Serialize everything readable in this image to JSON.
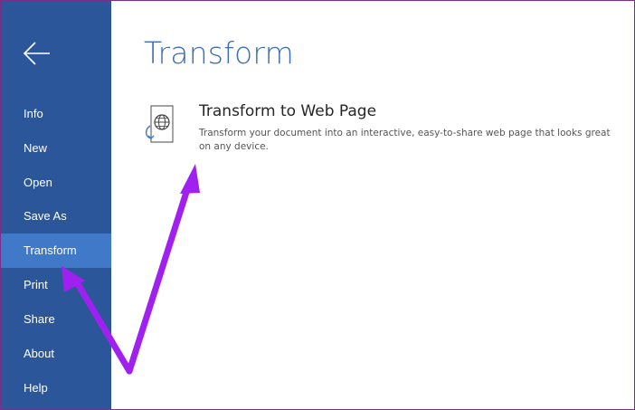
{
  "sidebar": {
    "back_icon": "back-arrow-icon",
    "items": [
      {
        "label": "Info"
      },
      {
        "label": "New"
      },
      {
        "label": "Open"
      },
      {
        "label": "Save As"
      },
      {
        "label": "Transform",
        "selected": true
      },
      {
        "label": "Print"
      },
      {
        "label": "Share"
      },
      {
        "label": "About"
      },
      {
        "label": "Help"
      }
    ]
  },
  "main": {
    "title": "Transform",
    "option": {
      "icon": "web-page-globe-icon",
      "title": "Transform to Web Page",
      "description": "Transform your document into an interactive, easy-to-share web page that looks great on any device."
    }
  },
  "colors": {
    "sidebar_bg": "#2b579a",
    "selected_bg": "#3f79c8",
    "title": "#3b6eb4",
    "annotation_arrow": "#a020f0"
  }
}
